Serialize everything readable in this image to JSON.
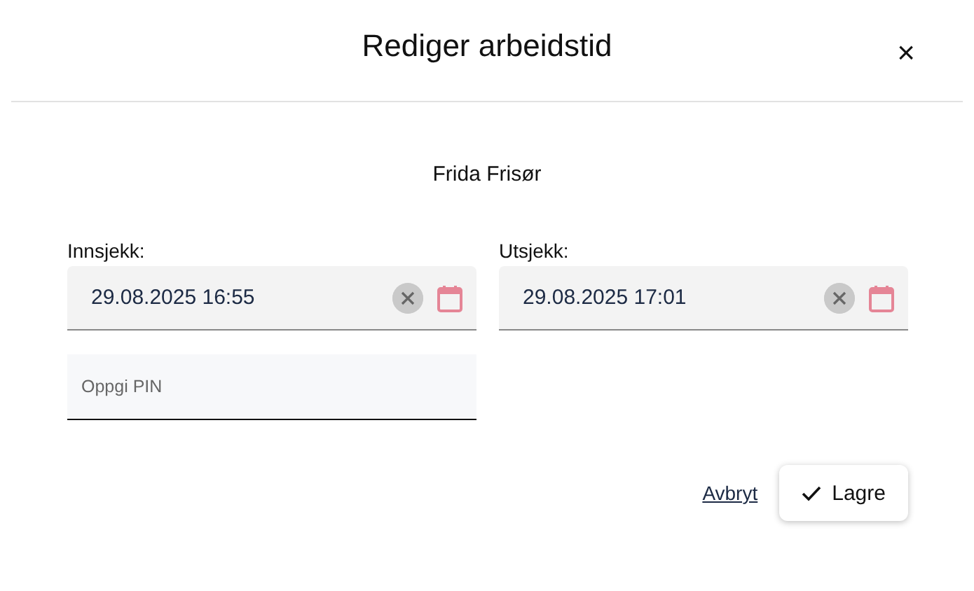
{
  "dialog": {
    "title": "Rediger arbeidstid",
    "close": "×"
  },
  "employee": "Frida Frisør",
  "fields": [
    {
      "label": "Innsjekk:",
      "value": "29.08.2025 16:55"
    },
    {
      "label": "Utsjekk:",
      "value": "29.08.2025 17:01"
    }
  ],
  "pin": {
    "placeholder": "Oppgi PIN"
  },
  "buttons": {
    "cancel": "Avbryt",
    "save": "Lagre"
  }
}
